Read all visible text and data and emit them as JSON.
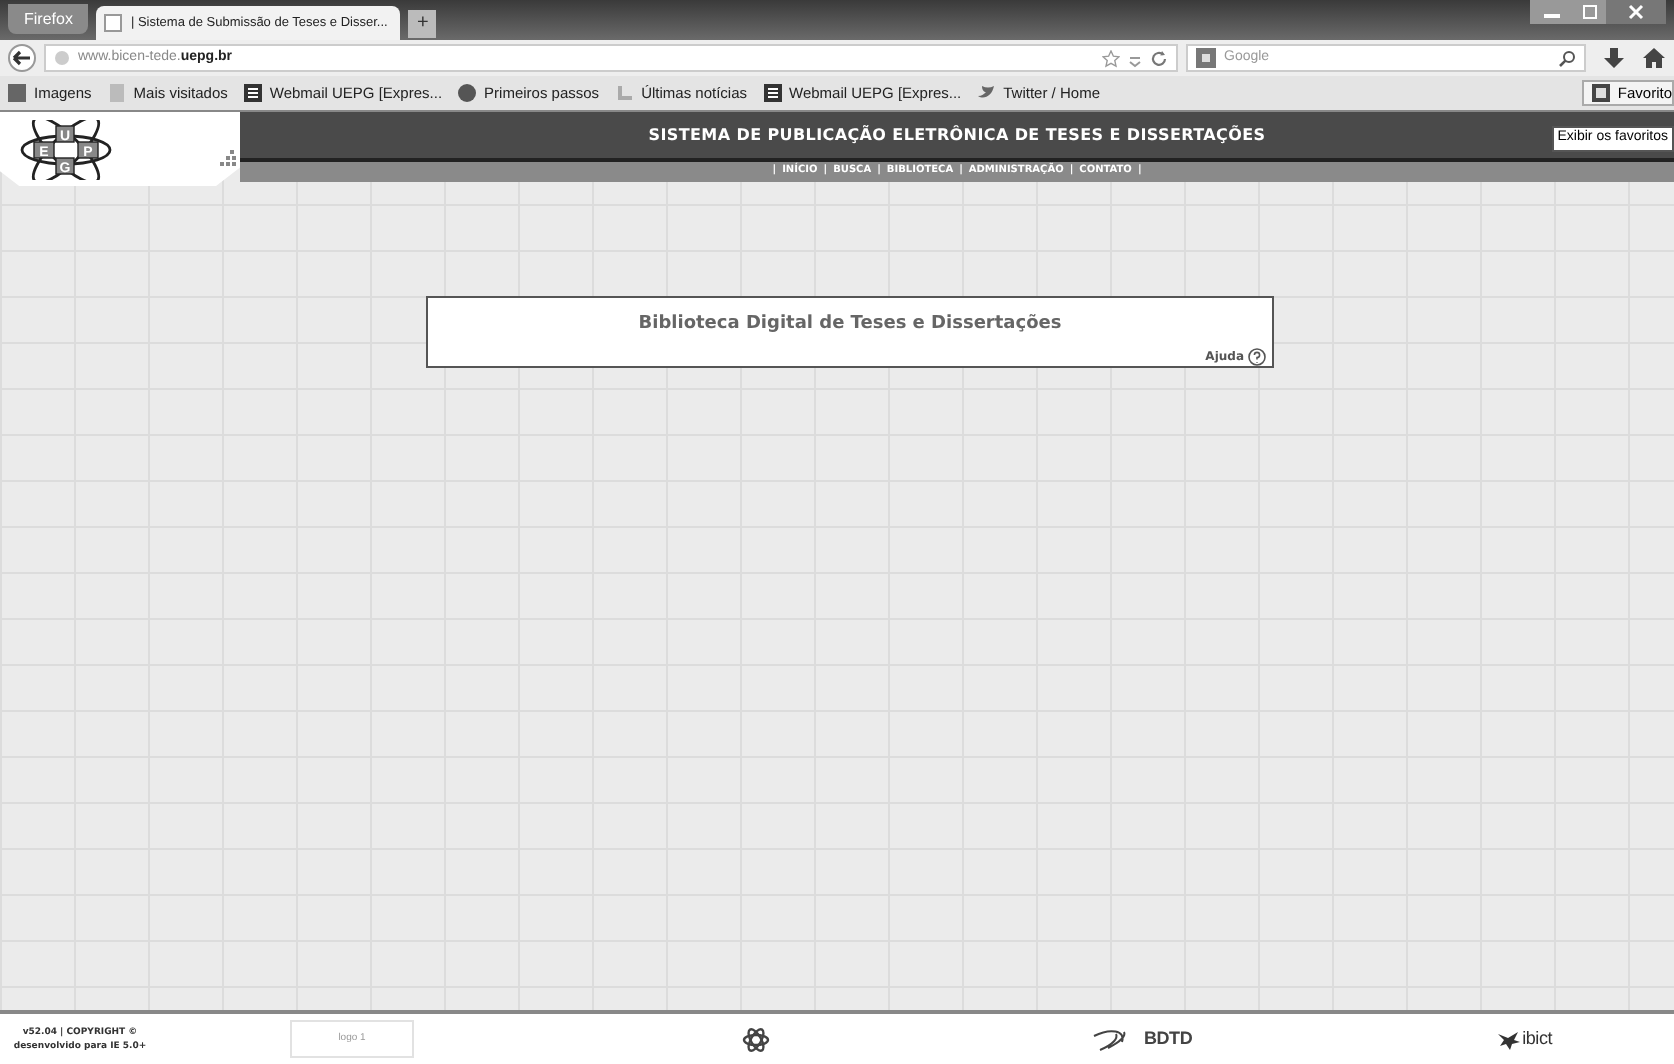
{
  "browser": {
    "menu_button": "Firefox",
    "tabs": [
      {
        "title": "| Sistema de Submissão de Teses e Disser...",
        "selected": true
      }
    ],
    "new_tab": "+",
    "address": {
      "host": "www.bicen-tede.",
      "domain": "uepg.br"
    },
    "search": {
      "placeholder": "Google"
    },
    "bookmarks": [
      {
        "label": "Imagens"
      },
      {
        "label": "Mais visitados"
      },
      {
        "label": "Webmail UEPG [Expres..."
      },
      {
        "label": "Primeiros passos"
      },
      {
        "label": "Últimas notícias"
      },
      {
        "label": "Webmail UEPG [Expres..."
      },
      {
        "label": "Twitter / Home"
      }
    ],
    "favorites_button": "Favorito",
    "tooltip": "Exibir os favoritos"
  },
  "site": {
    "logo_letters": [
      "U",
      "E",
      "P",
      "G"
    ],
    "title": "SISTEMA DE PUBLICAÇÃO ELETRÔNICA DE TESES E DISSERTAÇÕES",
    "separator": "|",
    "nav": [
      {
        "label": "INÍCIO"
      },
      {
        "label": "BUSCA"
      },
      {
        "label": "BIBLIOTECA"
      },
      {
        "label": "ADMINISTRAÇÃO"
      },
      {
        "label": "CONTATO"
      }
    ],
    "card": {
      "heading": "Biblioteca Digital de Teses e Dissertações",
      "help": "Ajuda"
    },
    "footer": {
      "version": "v52.04 | COPYRIGHT ©",
      "note": "desenvolvido para IE 5.0+",
      "logo_placeholder": "logo 1",
      "bdtd": "BDTD",
      "ibict": "ibict"
    }
  }
}
